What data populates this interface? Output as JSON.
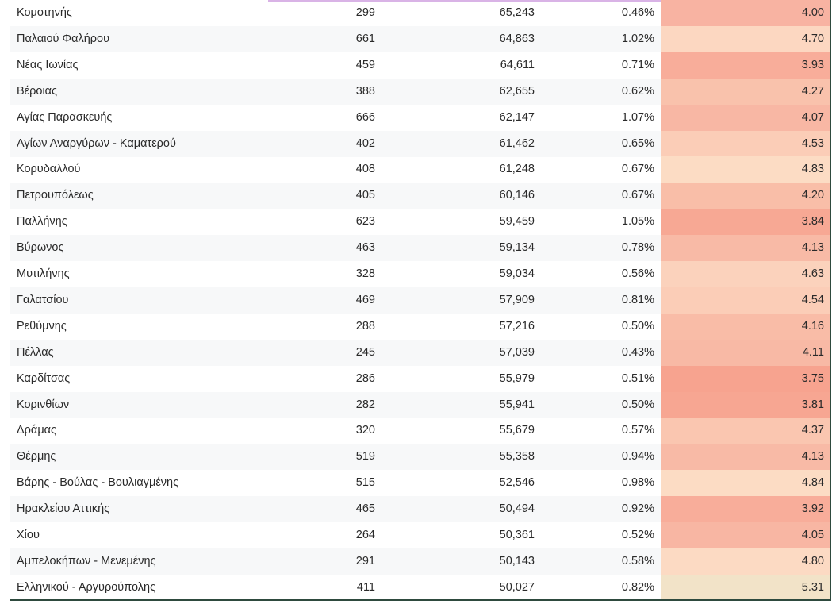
{
  "table": {
    "rows": [
      {
        "name": "Κομοτηνής",
        "count": "299",
        "population": "65,243",
        "percent": "0.46%",
        "score": "4.00",
        "color": "#f8b3a2"
      },
      {
        "name": "Παλαιού Φαλήρου",
        "count": "661",
        "population": "64,863",
        "percent": "1.02%",
        "score": "4.70",
        "color": "#fcd7c1"
      },
      {
        "name": "Νέας Ιωνίας",
        "count": "459",
        "population": "64,611",
        "percent": "0.71%",
        "score": "3.93",
        "color": "#f8ad9a"
      },
      {
        "name": "Βέροιας",
        "count": "388",
        "population": "62,655",
        "percent": "0.62%",
        "score": "4.27",
        "color": "#f9c2ac"
      },
      {
        "name": "Αγίας Παρασκευής",
        "count": "666",
        "population": "62,147",
        "percent": "1.07%",
        "score": "4.07",
        "color": "#f8b7a4"
      },
      {
        "name": "Αγίων Αναργύρων - Καματερού",
        "count": "402",
        "population": "61,462",
        "percent": "0.65%",
        "score": "4.53",
        "color": "#fbcdb7"
      },
      {
        "name": "Κορυδαλλού",
        "count": "408",
        "population": "61,248",
        "percent": "0.67%",
        "score": "4.83",
        "color": "#fcdcc4"
      },
      {
        "name": "Πετρουπόλεως",
        "count": "405",
        "population": "60,146",
        "percent": "0.67%",
        "score": "4.20",
        "color": "#f9bea8"
      },
      {
        "name": "Παλλήνης",
        "count": "623",
        "population": "59,459",
        "percent": "1.05%",
        "score": "3.84",
        "color": "#f7a894"
      },
      {
        "name": "Βύρωνος",
        "count": "463",
        "population": "59,134",
        "percent": "0.78%",
        "score": "4.13",
        "color": "#f8baa6"
      },
      {
        "name": "Μυτιλήνης",
        "count": "328",
        "population": "59,034",
        "percent": "0.56%",
        "score": "4.63",
        "color": "#fbd2bc"
      },
      {
        "name": "Γαλατσίου",
        "count": "469",
        "population": "57,909",
        "percent": "0.81%",
        "score": "4.54",
        "color": "#fbcdb7"
      },
      {
        "name": "Ρεθύμνης",
        "count": "288",
        "population": "57,216",
        "percent": "0.50%",
        "score": "4.16",
        "color": "#f9bca7"
      },
      {
        "name": "Πέλλας",
        "count": "245",
        "population": "57,039",
        "percent": "0.43%",
        "score": "4.11",
        "color": "#f8b9a5"
      },
      {
        "name": "Καρδίτσας",
        "count": "286",
        "population": "55,979",
        "percent": "0.51%",
        "score": "3.75",
        "color": "#f7a38f"
      },
      {
        "name": "Κορινθίων",
        "count": "282",
        "population": "55,941",
        "percent": "0.50%",
        "score": "3.81",
        "color": "#f7a692"
      },
      {
        "name": "Δράμας",
        "count": "320",
        "population": "55,679",
        "percent": "0.57%",
        "score": "4.37",
        "color": "#fac6b0"
      },
      {
        "name": "Θέρμης",
        "count": "519",
        "population": "55,358",
        "percent": "0.94%",
        "score": "4.13",
        "color": "#f8baa6"
      },
      {
        "name": "Βάρης - Βούλας - Βουλιαγμένης",
        "count": "515",
        "population": "52,546",
        "percent": "0.98%",
        "score": "4.84",
        "color": "#fcdcc4"
      },
      {
        "name": "Ηρακλείου Αττικής",
        "count": "465",
        "population": "50,494",
        "percent": "0.92%",
        "score": "3.92",
        "color": "#f8ad9a"
      },
      {
        "name": "Χίου",
        "count": "264",
        "population": "50,361",
        "percent": "0.52%",
        "score": "4.05",
        "color": "#f8b6a3"
      },
      {
        "name": "Αμπελοκήπων - Μενεμένης",
        "count": "291",
        "population": "50,143",
        "percent": "0.58%",
        "score": "4.80",
        "color": "#fcdac3"
      },
      {
        "name": "Ελληνικού - Αργυρούπολης",
        "count": "411",
        "population": "50,027",
        "percent": "0.82%",
        "score": "5.31",
        "color": "#f2e3c8"
      }
    ]
  }
}
